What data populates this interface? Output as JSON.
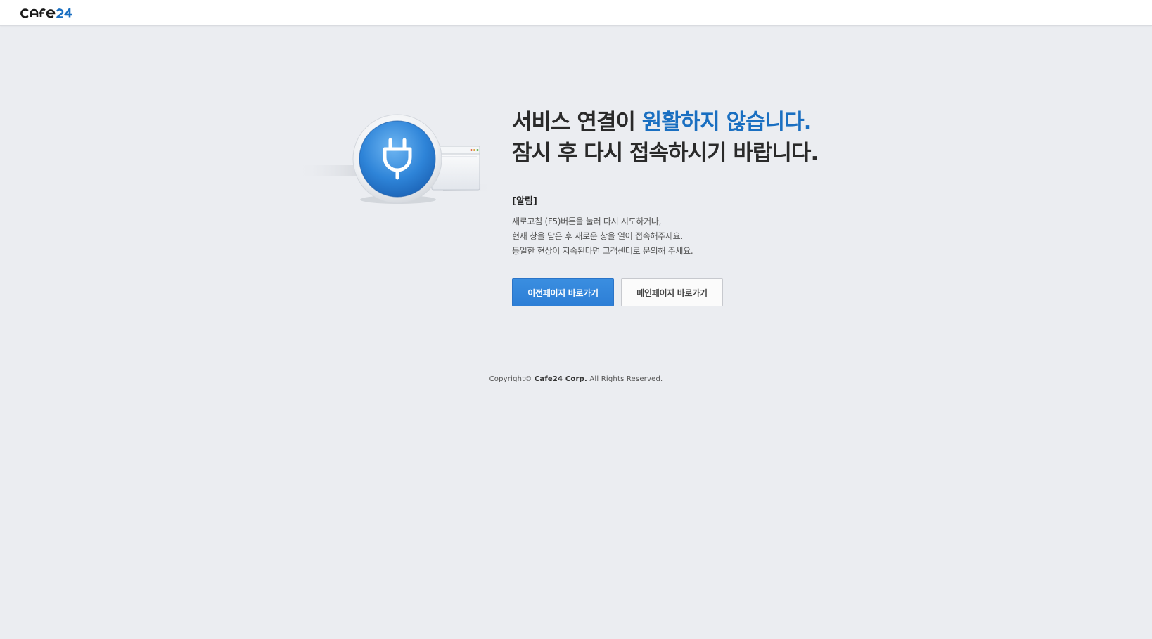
{
  "header": {
    "logo_alt": "cafe24"
  },
  "illustration": {
    "icon": "plug-icon",
    "accent_color": "#2f7fd3"
  },
  "headline": {
    "line1_part1": "서비스 연결이 ",
    "line1_accent": "원활하지 않습니다.",
    "line2": "잠시 후 다시 접속하시기 바랍니다."
  },
  "notice": {
    "title": "[알림]",
    "lines": [
      "새로고침 (F5)버튼을 눌러 다시 시도하거나,",
      "현재 창을 닫은 후 새로운 창을 열어 접속해주세요.",
      "동일한 현상이 지속된다면 고객센터로 문의해 주세요."
    ]
  },
  "buttons": {
    "previous_label": "이전페이지 바로가기",
    "main_label": "메인페이지 바로가기"
  },
  "footer": {
    "prefix": "Copyright© ",
    "company": "Cafe24 Corp.",
    "suffix": " All Rights Reserved."
  },
  "colors": {
    "background": "#ebedf1",
    "accent": "#1a6fc1",
    "primary_button": "#2d7ed6"
  }
}
